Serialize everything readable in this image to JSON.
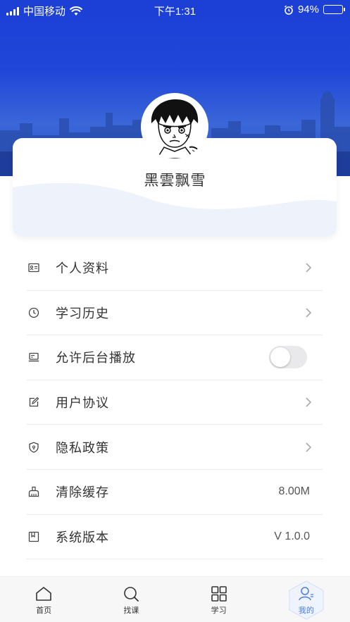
{
  "status_bar": {
    "carrier": "中国移动",
    "time": "下午1:31",
    "battery": "94%",
    "battery_level": 0.94
  },
  "profile": {
    "username": "黑雲飘雪"
  },
  "menu": {
    "items": [
      {
        "label": "个人资料",
        "icon": "id-card-icon",
        "trailing": "chevron"
      },
      {
        "label": "学习历史",
        "icon": "clock-icon",
        "trailing": "chevron"
      },
      {
        "label": "允许后台播放",
        "icon": "laptop-icon",
        "trailing": "toggle",
        "toggle_on": false
      },
      {
        "label": "用户协议",
        "icon": "edit-icon",
        "trailing": "chevron"
      },
      {
        "label": "隐私政策",
        "icon": "shield-icon",
        "trailing": "chevron"
      },
      {
        "label": "清除缓存",
        "icon": "broom-icon",
        "trailing": "value",
        "value": "8.00M"
      },
      {
        "label": "系统版本",
        "icon": "bookmark-icon",
        "trailing": "value",
        "value": "V 1.0.0"
      }
    ]
  },
  "tabbar": {
    "tabs": [
      {
        "label": "首页",
        "icon": "home-icon"
      },
      {
        "label": "找课",
        "icon": "search-icon"
      },
      {
        "label": "学习",
        "icon": "grid-icon"
      },
      {
        "label": "我的",
        "icon": "user-icon",
        "active": true
      }
    ]
  },
  "colors": {
    "header_blue": "#1f46d8",
    "accent": "#4a7cf0",
    "card_wave": "#eef3fb"
  }
}
